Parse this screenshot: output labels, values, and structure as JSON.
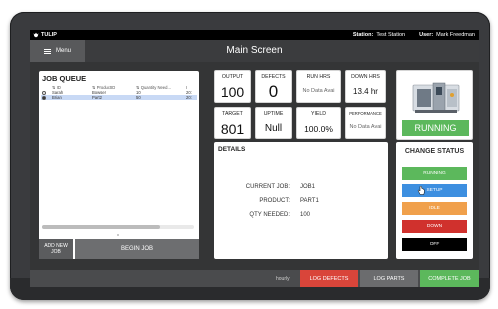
{
  "system_bar": {
    "app_name": "TULIP",
    "station_label": "Station:",
    "station_value": "Test Station",
    "user_label": "User:",
    "user_value": "Mark Freedman"
  },
  "header": {
    "menu_label": "Menu",
    "title": "Main Screen"
  },
  "job_queue": {
    "title": "JOB QUEUE",
    "columns": [
      "ID",
      "ProductID",
      "Quantity Need...",
      "I"
    ],
    "rows": [
      {
        "id": "Sarah",
        "product": "Bowser",
        "quantity": "10",
        "extra": "20:",
        "selected": false
      },
      {
        "id": "Brian",
        "product": "Part2",
        "quantity": "50",
        "extra": "20:",
        "selected": true
      }
    ],
    "add_new_job": "ADD NEW JOB",
    "begin_job": "BEGIN JOB"
  },
  "metrics": {
    "output": {
      "title": "OUTPUT",
      "value": "100"
    },
    "defects": {
      "title": "DEFECTS",
      "value": "0"
    },
    "run_hrs": {
      "title": "RUN HRS",
      "value": "No Data Avai"
    },
    "down_hrs": {
      "title": "DOWN HRS",
      "value": "13.4 hr"
    },
    "target": {
      "title": "TARGET",
      "value": "801"
    },
    "uptime": {
      "title": "UPTIME",
      "value": "Null"
    },
    "yield": {
      "title": "YIELD",
      "value": "100.0%"
    },
    "performance": {
      "title": "PERFORMANCE",
      "value": "No Data Avai"
    }
  },
  "machine": {
    "status": "RUNNING",
    "status_color": "#5cb85c"
  },
  "details": {
    "title": "DETAILS",
    "current_job_label": "CURRENT JOB:",
    "current_job_value": "JOB1",
    "product_label": "PRODUCT:",
    "product_value": "PART1",
    "qty_label": "QTY NEEDED:",
    "qty_value": "100"
  },
  "change_status": {
    "title": "CHANGE STATUS",
    "buttons": [
      {
        "label": "RUNNING",
        "color": "#5cb85c"
      },
      {
        "label": "SETUP",
        "color": "#3d8fe0"
      },
      {
        "label": "IDLE",
        "color": "#f0a04b"
      },
      {
        "label": "DOWN",
        "color": "#d0312d"
      },
      {
        "label": "OFF",
        "color": "#000000"
      }
    ]
  },
  "bottom_bar": {
    "hourly_label": "hourly",
    "log_defects": "LOG DEFECTS",
    "log_parts": "LOG PARTS",
    "complete_job": "COMPLETE JOB",
    "log_defects_color": "#d9453a",
    "log_parts_color": "#6b6c6e",
    "complete_job_color": "#5cb85c"
  }
}
